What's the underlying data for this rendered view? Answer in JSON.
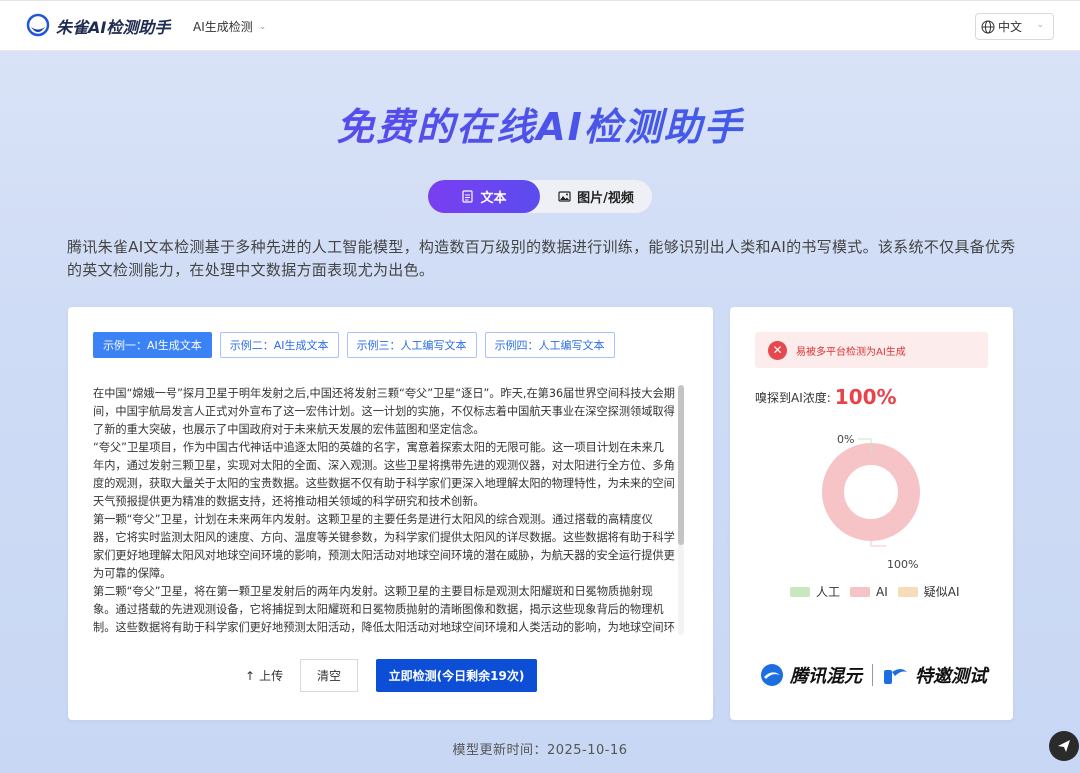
{
  "header": {
    "logo_text": "朱雀AI检测助手",
    "nav": {
      "label": "AI生成检测"
    },
    "language": "中文"
  },
  "hero": {
    "title": "免费的在线AI检测助手",
    "tabs": {
      "text": "文本",
      "media": "图片/视频"
    },
    "intro": "腾讯朱雀AI文本检测基于多种先进的人工智能模型，构造数百万级别的数据进行训练，能够识别出人类和AI的书写模式。该系统不仅具备优秀的英文检测能力，在处理中文数据方面表现尤为出色。"
  },
  "input_panel": {
    "samples": [
      "示例一：AI生成文本",
      "示例二：AI生成文本",
      "示例三：人工编写文本",
      "示例四：人工编写文本"
    ],
    "paragraphs": [
      "在中国“嫦娥一号”探月卫星于明年发射之后,中国还将发射三颗“夸父”卫星“逐日”。昨天,在第36届世界空间科技大会期间，中国宇航局发言人正式对外宣布了这一宏伟计划。这一计划的实施，不仅标志着中国航天事业在深空探测领域取得了新的重大突破，也展示了中国政府对于未来航天发展的宏伟蓝图和坚定信念。",
      "“夸父”卫星项目，作为中国古代神话中追逐太阳的英雄的名字，寓意着探索太阳的无限可能。这一项目计划在未来几年内，通过发射三颗卫星，实现对太阳的全面、深入观测。这些卫星将携带先进的观测仪器，对太阳进行全方位、多角度的观测，获取大量关于太阳的宝贵数据。这些数据不仅有助于科学家们更深入地理解太阳的物理特性，为未来的空间天气预报提供更为精准的数据支持，还将推动相关领域的科学研究和技术创新。",
      "第一颗“夸父”卫星，计划在未来两年内发射。这颗卫星的主要任务是进行太阳风的综合观测。通过搭载的高精度仪器，它将实时监测太阳风的速度、方向、温度等关键参数，为科学家们提供太阳风的详尽数据。这些数据将有助于科学家们更好地理解太阳风对地球空间环境的影响，预测太阳活动对地球空间环境的潜在威胁，为航天器的安全运行提供更为可靠的保障。",
      "第二颗“夸父”卫星，将在第一颗卫星发射后的两年内发射。这颗卫星的主要目标是观测太阳耀斑和日冕物质抛射现象。通过搭载的先进观测设备，它将捕捉到太阳耀斑和日冕物质抛射的清晰图像和数据，揭示这些现象背后的物理机制。这些数据将有助于科学家们更好地预测太阳活动，降低太阳活动对地球空间环境和人类活动的影响，为地球空间环境的稳定和安全提供有力支持。"
    ],
    "upload_label": "上传",
    "clear_label": "清空",
    "detect_label": "立即检测(今日剩余19次)"
  },
  "result_panel": {
    "alert": "易被多平台检测为AI生成",
    "concentration_label": "嗅探到AI浓度:",
    "concentration_value": "100%",
    "chart_data": {
      "type": "pie",
      "categories": [
        "人工",
        "AI",
        "疑似AI"
      ],
      "values": [
        0,
        100,
        0
      ],
      "labels": [
        "0%",
        "100%"
      ],
      "colors": [
        "#c8e6c0",
        "#f6c4c6",
        "#f7dcbc"
      ]
    },
    "brands": [
      "腾讯混元",
      "特邀测试"
    ]
  },
  "footer": {
    "text": "模型更新时间：2025-10-16"
  }
}
